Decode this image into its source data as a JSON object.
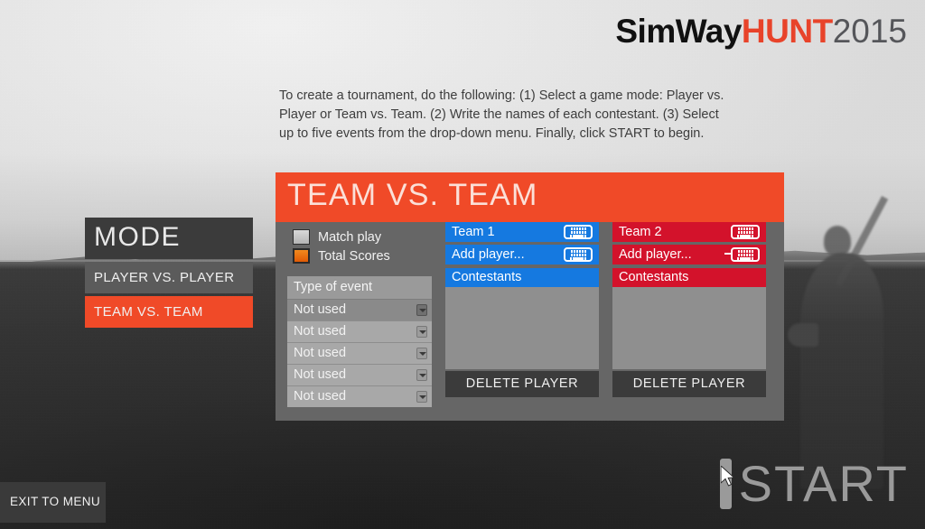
{
  "logo": {
    "part1": "SimWay",
    "part2": "HUNT",
    "part3": "2015",
    "colors": {
      "part1": "#111111",
      "part2": "#e8432a",
      "part3": "#55565a"
    }
  },
  "instructions": {
    "line1": "To create a tournament, do the following: (1) Select a game mode: Player vs.",
    "line2": "Player or Team vs. Team. (2) Write the names of each contestant. (3) Select",
    "line3": "up to five events from the drop-down menu. Finally, click START to begin."
  },
  "mode_panel": {
    "title": "MODE",
    "items": [
      {
        "label": "PLAYER VS. PLAYER",
        "selected": false
      },
      {
        "label": "TEAM VS. TEAM",
        "selected": true
      }
    ]
  },
  "config_panel": {
    "header": "TEAM VS. TEAM",
    "scoring_options": [
      {
        "label": "Match play",
        "checked": false
      },
      {
        "label": "Total Scores",
        "checked": true
      }
    ],
    "event_section": {
      "header": "Type of event",
      "rows": [
        {
          "value": "Not used",
          "active": true
        },
        {
          "value": "Not used",
          "active": false
        },
        {
          "value": "Not used",
          "active": false
        },
        {
          "value": "Not used",
          "active": false
        },
        {
          "value": "Not used",
          "active": false
        }
      ]
    },
    "teams": [
      {
        "name_value": "Team 1",
        "add_player_value": "Add player...",
        "has_text_cursor": false,
        "contestants_header": "Contestants",
        "contestants": [],
        "delete_label": "DELETE PLAYER",
        "color": "#1579e0"
      },
      {
        "name_value": "Team 2",
        "add_player_value": "Add player...",
        "has_text_cursor": true,
        "contestants_header": "Contestants",
        "contestants": [],
        "delete_label": "DELETE PLAYER",
        "color": "#d3122b"
      }
    ]
  },
  "footer": {
    "exit_label": "EXIT TO MENU",
    "start_label": "START"
  },
  "theme": {
    "accent_red": "#f04a28",
    "team1_blue": "#1579e0",
    "team2_red": "#d3122b",
    "panel_gray": "#666666",
    "dark_gray": "#3b3b3b"
  }
}
